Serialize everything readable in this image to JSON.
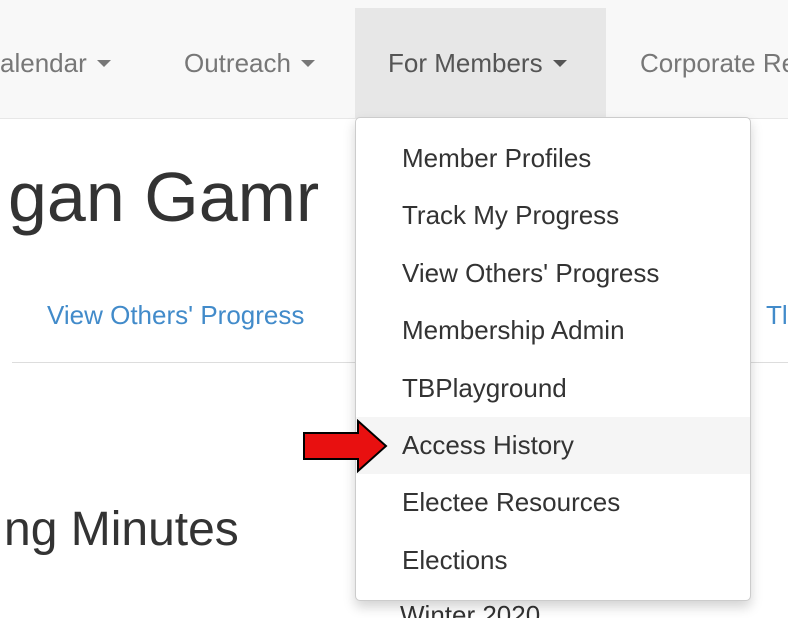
{
  "navbar": {
    "items": [
      {
        "label": "alendar",
        "active": false
      },
      {
        "label": "Outreach",
        "active": false
      },
      {
        "label": "For Members",
        "active": true
      },
      {
        "label": "Corporate Re",
        "active": false
      }
    ]
  },
  "page": {
    "title": "gan Gamr",
    "subnav": {
      "left_link": "View Others' Progress",
      "right_link": "Tl"
    },
    "section_heading": "ng Minutes",
    "cut_off_text": "Winter 2020"
  },
  "dropdown": {
    "items": [
      {
        "label": "Member Profiles",
        "highlighted": false
      },
      {
        "label": "Track My Progress",
        "highlighted": false
      },
      {
        "label": "View Others' Progress",
        "highlighted": false
      },
      {
        "label": "Membership Admin",
        "highlighted": false
      },
      {
        "label": "TBPlayground",
        "highlighted": false
      },
      {
        "label": "Access History",
        "highlighted": true
      },
      {
        "label": "Electee Resources",
        "highlighted": false
      },
      {
        "label": "Elections",
        "highlighted": false
      }
    ]
  },
  "colors": {
    "navbar_bg": "#f8f8f8",
    "active_tab_bg": "#e7e7e7",
    "link": "#428bca",
    "arrow_fill": "#e81010",
    "arrow_stroke": "#000000"
  }
}
